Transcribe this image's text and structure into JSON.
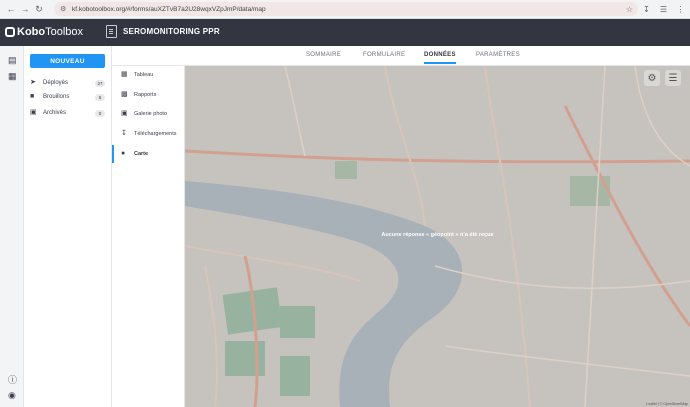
{
  "browser": {
    "url": "kf.kobotoolbox.org/#/forms/auXZTvB7a2U28wqxVZpJmP/data/map",
    "back_icon": "arrow-left-icon",
    "forward_icon": "arrow-right-icon",
    "reload_icon": "reload-icon"
  },
  "header": {
    "logo_bold": "Kobo",
    "logo_light": "Toolbox",
    "project_title": "SEROMONITORING PPR"
  },
  "sidebar": {
    "new_label": "NOUVEAU",
    "items": [
      {
        "label": "Déployés",
        "count": "27",
        "icon": "rocket-icon"
      },
      {
        "label": "Brouillons",
        "count": "5",
        "icon": "draft-icon"
      },
      {
        "label": "Archivés",
        "count": "0",
        "icon": "archive-icon"
      }
    ]
  },
  "tabs": [
    {
      "label": "SOMMAIRE"
    },
    {
      "label": "FORMULAIRE"
    },
    {
      "label": "DONNÉES",
      "active": true
    },
    {
      "label": "PARAMÈTRES"
    }
  ],
  "subnav": [
    {
      "label": "Tableau",
      "icon": "table-icon"
    },
    {
      "label": "Rapports",
      "icon": "reports-icon"
    },
    {
      "label": "Galerie photo",
      "icon": "gallery-icon"
    },
    {
      "label": "Téléchargements",
      "icon": "download-icon"
    },
    {
      "label": "Carte",
      "icon": "map-pin-icon",
      "active": true
    }
  ],
  "map": {
    "message": "Aucune réponse « géopoint » n’a été reçue",
    "attribution": "Leaflet | © OpenStreetMap"
  },
  "colors": {
    "accent": "#2095f3",
    "topbar": "#333640",
    "map_overlay": "#bdbcbb"
  }
}
